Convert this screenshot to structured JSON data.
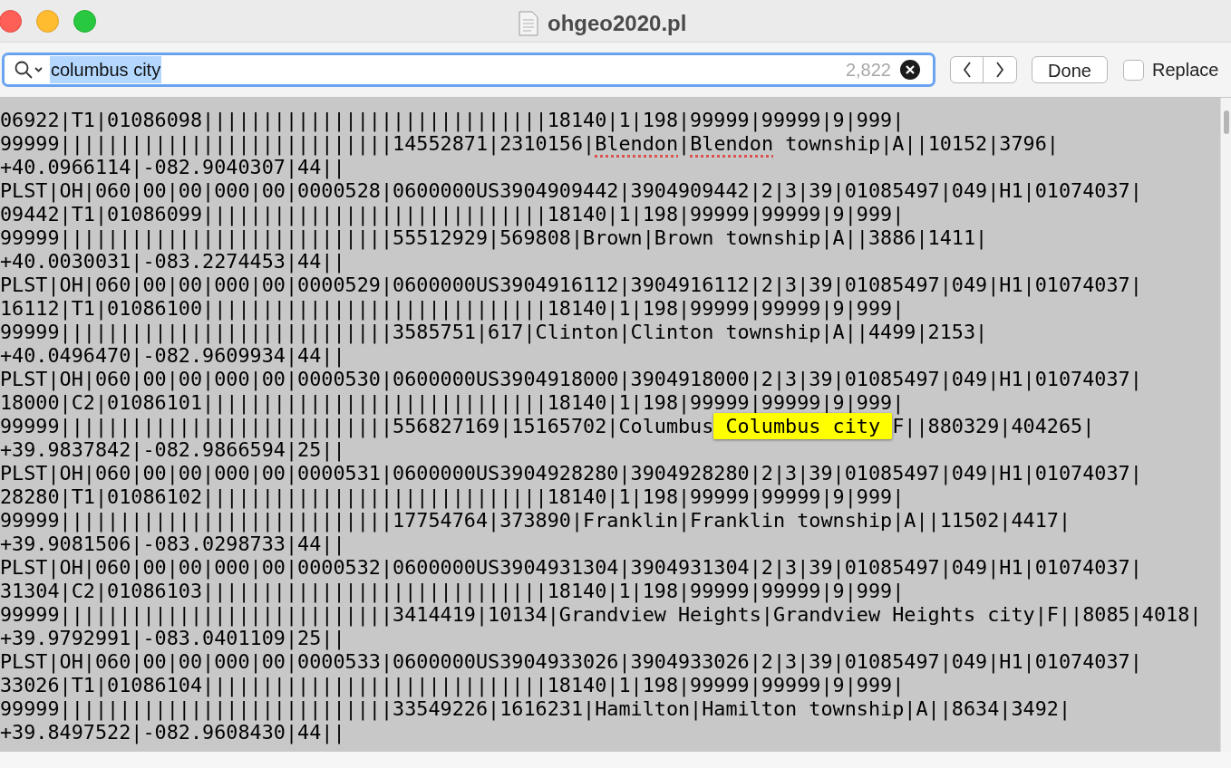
{
  "window": {
    "title": "ohgeo2020.pl"
  },
  "find_bar": {
    "query": "columbus city",
    "query_selected": true,
    "match_count": "2,822",
    "done_button": "Done",
    "replace": {
      "label": "Replace",
      "checked": false
    }
  },
  "lines": [
    {
      "segments": [
        {
          "kind": "plain",
          "text": "06922|T1|01086098|||||||||||||||||||||||||||||18140|1|198|99999|99999|9|999|"
        }
      ]
    },
    {
      "segments": [
        {
          "kind": "plain",
          "text": "99999||||||||||||||||||||||||||||14552871|2310156|"
        },
        {
          "kind": "misspelled",
          "text": "Blendon"
        },
        {
          "kind": "plain",
          "text": "|"
        },
        {
          "kind": "misspelled",
          "text": "Blendon"
        },
        {
          "kind": "plain",
          "text": " township|A||10152|3796|"
        }
      ]
    },
    {
      "segments": [
        {
          "kind": "plain",
          "text": "+40.0966114|-082.9040307|44||"
        }
      ]
    },
    {
      "segments": [
        {
          "kind": "plain",
          "text": "PLST|OH|060|00|00|000|00|0000528|0600000US3904909442|3904909442|2|3|39|01085497|049|H1|01074037|"
        }
      ]
    },
    {
      "segments": [
        {
          "kind": "plain",
          "text": "09442|T1|01086099|||||||||||||||||||||||||||||18140|1|198|99999|99999|9|999|"
        }
      ]
    },
    {
      "segments": [
        {
          "kind": "plain",
          "text": "99999||||||||||||||||||||||||||||55512929|569808|Brown|Brown township|A||3886|1411|"
        }
      ]
    },
    {
      "segments": [
        {
          "kind": "plain",
          "text": "+40.0030031|-083.2274453|44||"
        }
      ]
    },
    {
      "segments": [
        {
          "kind": "plain",
          "text": "PLST|OH|060|00|00|000|00|0000529|0600000US3904916112|3904916112|2|3|39|01085497|049|H1|01074037|"
        }
      ]
    },
    {
      "segments": [
        {
          "kind": "plain",
          "text": "16112|T1|01086100|||||||||||||||||||||||||||||18140|1|198|99999|99999|9|999|"
        }
      ]
    },
    {
      "segments": [
        {
          "kind": "plain",
          "text": "99999||||||||||||||||||||||||||||3585751|617|Clinton|Clinton township|A||4499|2153|"
        }
      ]
    },
    {
      "segments": [
        {
          "kind": "plain",
          "text": "+40.0496470|-082.9609934|44||"
        }
      ]
    },
    {
      "segments": [
        {
          "kind": "plain",
          "text": "PLST|OH|060|00|00|000|00|0000530|0600000US3904918000|3904918000|2|3|39|01085497|049|H1|01074037|"
        }
      ]
    },
    {
      "segments": [
        {
          "kind": "plain",
          "text": "18000|C2|01086101|||||||||||||||||||||||||||||18140|1|198|99999|99999|9|999|"
        }
      ]
    },
    {
      "segments": [
        {
          "kind": "plain",
          "text": "99999||||||||||||||||||||||||||||556827169|15165702|Columbus"
        },
        {
          "kind": "match",
          "text": "Columbus city"
        },
        {
          "kind": "plain",
          "text": "F||880329|404265|"
        }
      ]
    },
    {
      "segments": [
        {
          "kind": "plain",
          "text": "+39.9837842|-082.9866594|25||"
        }
      ]
    },
    {
      "segments": [
        {
          "kind": "plain",
          "text": "PLST|OH|060|00|00|000|00|0000531|0600000US3904928280|3904928280|2|3|39|01085497|049|H1|01074037|"
        }
      ]
    },
    {
      "segments": [
        {
          "kind": "plain",
          "text": "28280|T1|01086102|||||||||||||||||||||||||||||18140|1|198|99999|99999|9|999|"
        }
      ]
    },
    {
      "segments": [
        {
          "kind": "plain",
          "text": "99999||||||||||||||||||||||||||||17754764|373890|Franklin|Franklin township|A||11502|4417|"
        }
      ]
    },
    {
      "segments": [
        {
          "kind": "plain",
          "text": "+39.9081506|-083.0298733|44||"
        }
      ]
    },
    {
      "segments": [
        {
          "kind": "plain",
          "text": "PLST|OH|060|00|00|000|00|0000532|0600000US3904931304|3904931304|2|3|39|01085497|049|H1|01074037|"
        }
      ]
    },
    {
      "segments": [
        {
          "kind": "plain",
          "text": "31304|C2|01086103|||||||||||||||||||||||||||||18140|1|198|99999|99999|9|999|"
        }
      ]
    },
    {
      "segments": [
        {
          "kind": "plain",
          "text": "99999||||||||||||||||||||||||||||3414419|10134|Grandview Heights|Grandview Heights city|F||8085|4018|"
        }
      ]
    },
    {
      "segments": [
        {
          "kind": "plain",
          "text": "+39.9792991|-083.0401109|25||"
        }
      ]
    },
    {
      "segments": [
        {
          "kind": "plain",
          "text": "PLST|OH|060|00|00|000|00|0000533|0600000US3904933026|3904933026|2|3|39|01085497|049|H1|01074037|"
        }
      ]
    },
    {
      "segments": [
        {
          "kind": "plain",
          "text": "33026|T1|01086104|||||||||||||||||||||||||||||18140|1|198|99999|99999|9|999|"
        }
      ]
    },
    {
      "segments": [
        {
          "kind": "plain",
          "text": "99999||||||||||||||||||||||||||||33549226|1616231|Hamilton|Hamilton township|A||8634|3492|"
        }
      ]
    },
    {
      "segments": [
        {
          "kind": "plain",
          "text": "+39.8497522|-082.9608430|44||"
        }
      ]
    }
  ]
}
